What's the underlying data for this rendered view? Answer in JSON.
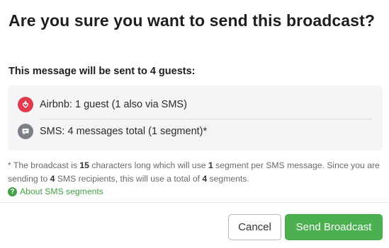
{
  "dialog": {
    "title": "Are you sure you want to send this broadcast?",
    "subtitle": "This message will be sent to 4 guests:",
    "channels": [
      {
        "icon": "airbnb-icon",
        "text": "Airbnb: 1 guest (1 also via SMS)",
        "color": "#e03a4e"
      },
      {
        "icon": "sms-icon",
        "text": "SMS: 4 messages total (1 segment)*",
        "color": "#7c7f86"
      }
    ],
    "note": {
      "p1": "* The broadcast is ",
      "chars": "15",
      "p2": " characters long which will use ",
      "segments_per": "1",
      "p3": " segment per SMS message. Since you are sending to ",
      "recipients": "4",
      "p4": " SMS recipients, this will use a total of ",
      "total_segments": "4",
      "p5": " segments."
    },
    "help_link": "About SMS segments",
    "buttons": {
      "cancel": "Cancel",
      "send": "Send Broadcast"
    },
    "colors": {
      "accent": "#4caf50",
      "link": "#43a047",
      "airbnb": "#e03a4e"
    }
  }
}
